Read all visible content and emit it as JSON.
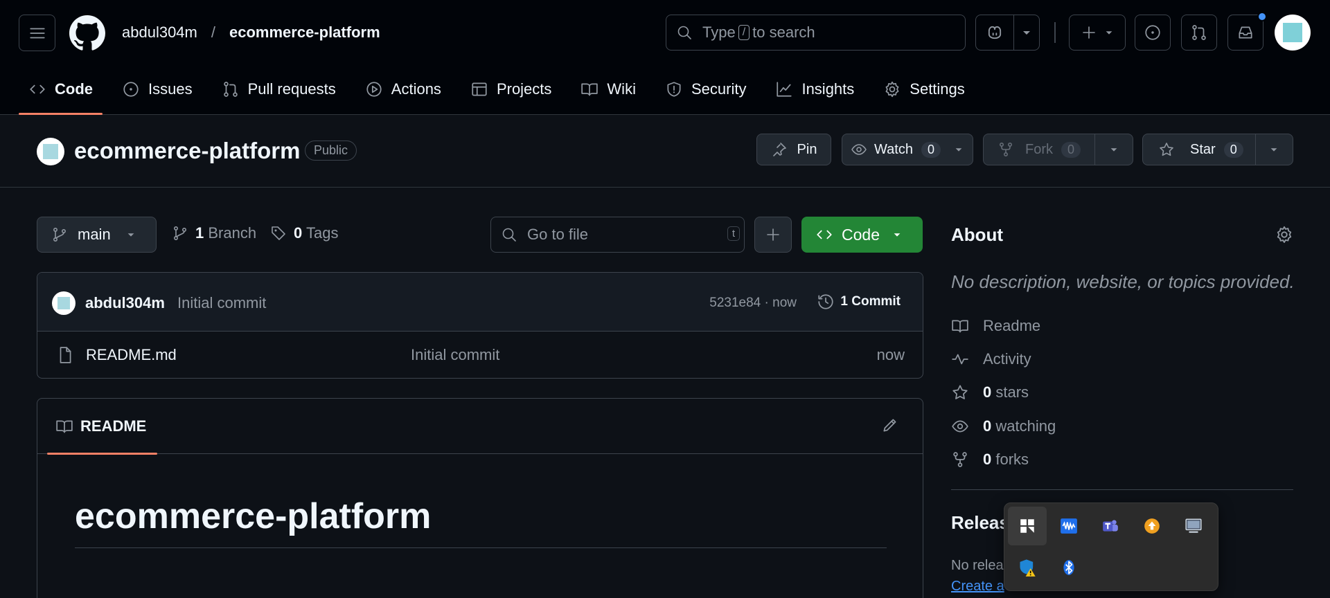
{
  "header": {
    "owner": "abdul304m",
    "separator": "/",
    "repo": "ecommerce-platform",
    "search_prefix": "Type",
    "search_key": "/",
    "search_suffix": "to search"
  },
  "nav": {
    "tabs": [
      {
        "label": "Code",
        "icon": "code-icon"
      },
      {
        "label": "Issues",
        "icon": "issue-icon"
      },
      {
        "label": "Pull requests",
        "icon": "pull-request-icon"
      },
      {
        "label": "Actions",
        "icon": "play-icon"
      },
      {
        "label": "Projects",
        "icon": "table-icon"
      },
      {
        "label": "Wiki",
        "icon": "book-icon"
      },
      {
        "label": "Security",
        "icon": "shield-icon"
      },
      {
        "label": "Insights",
        "icon": "graph-icon"
      },
      {
        "label": "Settings",
        "icon": "gear-icon"
      }
    ]
  },
  "repo": {
    "title": "ecommerce-platform",
    "visibility": "Public",
    "pin_label": "Pin",
    "watch_label": "Watch",
    "watch_count": "0",
    "fork_label": "Fork",
    "fork_count": "0",
    "star_label": "Star",
    "star_count": "0"
  },
  "toolbar": {
    "branch": "main",
    "branch_count": "1",
    "branch_label": "Branch",
    "tag_count": "0",
    "tag_label": "Tags",
    "goto_placeholder": "Go to file",
    "goto_key": "t",
    "code_label": "Code"
  },
  "commit": {
    "author": "abdul304m",
    "message": "Initial commit",
    "sha_time": "5231e84 · now",
    "commits_label": "1 Commit"
  },
  "files": [
    {
      "name": "README.md",
      "message": "Initial commit",
      "time": "now"
    }
  ],
  "readme": {
    "tab_label": "README",
    "heading": "ecommerce-platform"
  },
  "about": {
    "title": "About",
    "description": "No description, website, or topics provided.",
    "readme": "Readme",
    "activity": "Activity",
    "stars_count": "0",
    "stars_label": "stars",
    "watching_count": "0",
    "watching_label": "watching",
    "forks_count": "0",
    "forks_label": "forks",
    "releases_title": "Releas",
    "releases_text": "No relea",
    "releases_link": "Create a"
  },
  "tray": {
    "icons": [
      "app-icon",
      "audio-meter-icon",
      "teams-icon",
      "update-icon",
      "display-icon",
      "security-warning-icon",
      "bluetooth-icon"
    ]
  },
  "colors": {
    "accent_underline": "#f78166",
    "code_button": "#238636",
    "link": "#4493f8"
  }
}
